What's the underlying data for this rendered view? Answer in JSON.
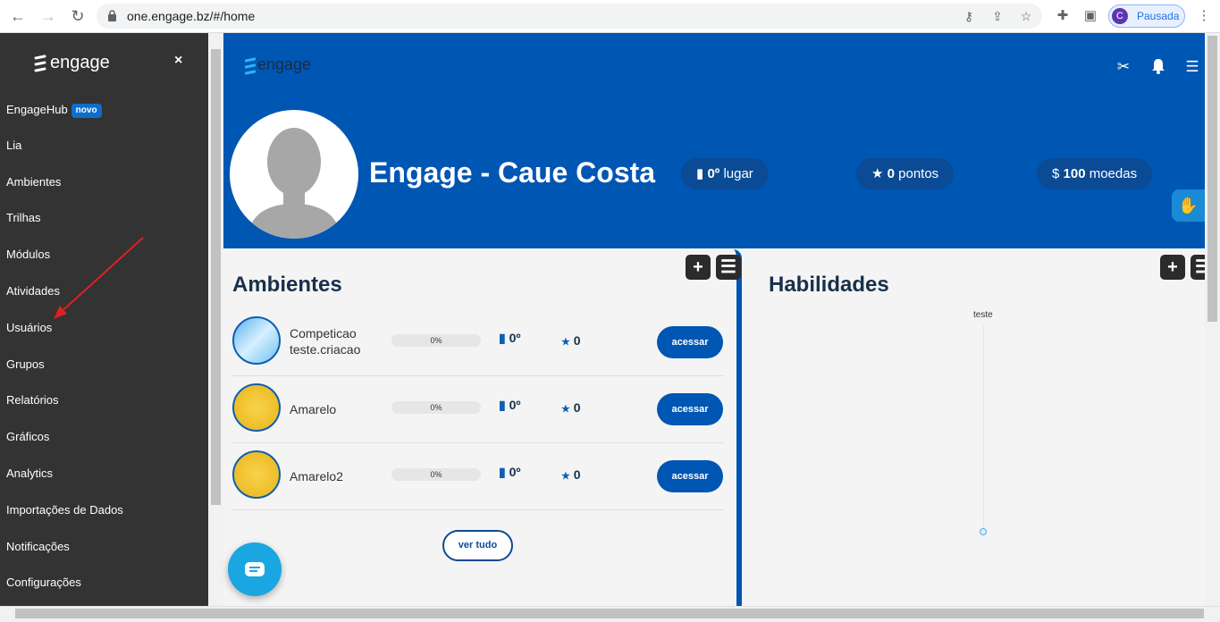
{
  "browser": {
    "url": "one.engage.bz/#/home",
    "profile_initial": "C",
    "profile_status": "Pausada"
  },
  "sidebar": {
    "logo": "engage",
    "close": "×",
    "items": [
      {
        "label": "EngageHub",
        "badge": "novo"
      },
      {
        "label": "Lia"
      },
      {
        "label": "Ambientes"
      },
      {
        "label": "Trilhas"
      },
      {
        "label": "Módulos"
      },
      {
        "label": "Atividades"
      },
      {
        "label": "Usuários"
      },
      {
        "label": "Grupos"
      },
      {
        "label": "Relatórios"
      },
      {
        "label": "Gráficos"
      },
      {
        "label": "Analytics"
      },
      {
        "label": "Importações de Dados"
      },
      {
        "label": "Notificações"
      },
      {
        "label": "Configurações"
      }
    ]
  },
  "header": {
    "logo": "engage",
    "user_name": "Engage - Caue Costa",
    "rank": "0º",
    "rank_label": "lugar",
    "points": "0",
    "points_label": "pontos",
    "coins": "100",
    "coins_label": "moedas"
  },
  "ambientes": {
    "title": "Ambientes",
    "rows": [
      {
        "name": "Competicao teste.criacao",
        "progress": "0%",
        "rank": "0º",
        "stars": "0",
        "button": "acessar"
      },
      {
        "name": "Amarelo",
        "progress": "0%",
        "rank": "0º",
        "stars": "0",
        "button": "acessar"
      },
      {
        "name": "Amarelo2",
        "progress": "0%",
        "rank": "0º",
        "stars": "0",
        "button": "acessar"
      }
    ],
    "see_all": "ver tudo"
  },
  "habilidades": {
    "title": "Habilidades",
    "skill_label": "teste"
  },
  "colors": {
    "brand_blue": "#0056b3",
    "sidebar_bg": "#333333",
    "chat_button": "#1aa6e0"
  }
}
